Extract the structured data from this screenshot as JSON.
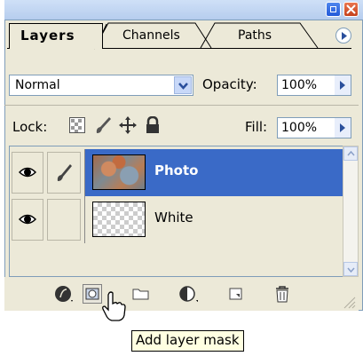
{
  "panel": {
    "tabs": [
      {
        "label": "Layers",
        "active": true
      },
      {
        "label": "Channels",
        "active": false
      },
      {
        "label": "Paths",
        "active": false
      }
    ],
    "blend_mode": "Normal",
    "opacity_label": "Opacity:",
    "opacity_value": "100%",
    "lock_label": "Lock:",
    "fill_label": "Fill:",
    "fill_value": "100%"
  },
  "layers": [
    {
      "name": "Photo",
      "selected": true,
      "visible": true,
      "thumbnail": "photo"
    },
    {
      "name": "White",
      "selected": false,
      "visible": true,
      "thumbnail": "transparent"
    }
  ],
  "bottom_toolbar": [
    "layer-style-icon",
    "add-layer-mask-icon",
    "new-group-icon",
    "adjustment-layer-icon",
    "new-layer-icon",
    "delete-layer-icon"
  ],
  "tooltip": "Add layer mask",
  "colors": {
    "panel_bg": "#ece9d8",
    "selection": "#3a6ac7",
    "titlebar_min": "#2f66e0",
    "titlebar_close": "#d9572f",
    "tooltip_bg": "#ffffe1"
  }
}
